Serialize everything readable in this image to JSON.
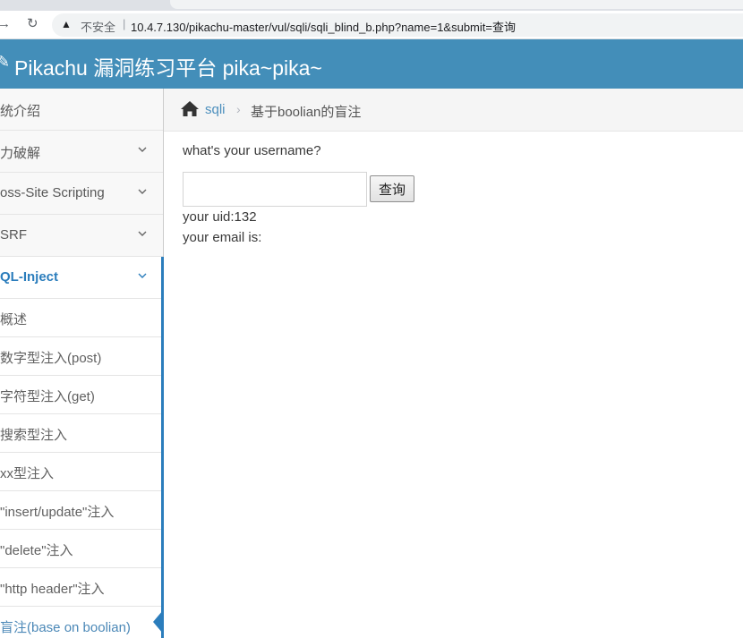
{
  "browser": {
    "forward_icon": "arrow-right",
    "reload_icon": "reload",
    "insecure_label": "不安全",
    "url": "10.4.7.130/pikachu-master/vul/sqli/sqli_blind_b.php?name=1&submit=查询"
  },
  "navbar": {
    "brand": "Pikachu 漏洞练习平台 pika~pika~",
    "color": "#438eb9"
  },
  "sidebar": {
    "items": [
      {
        "label": "统介绍"
      },
      {
        "label": "力破解"
      },
      {
        "label": "oss-Site Scripting"
      },
      {
        "label": "SRF"
      },
      {
        "label": "QL-Inject"
      }
    ],
    "subitems": [
      {
        "label": "概述"
      },
      {
        "label": "数字型注入(post)"
      },
      {
        "label": "字符型注入(get)"
      },
      {
        "label": "搜索型注入"
      },
      {
        "label": "xx型注入"
      },
      {
        "label": "\"insert/update\"注入"
      },
      {
        "label": "\"delete\"注入"
      },
      {
        "label": "\"http header\"注入"
      },
      {
        "label": "盲注(base on boolian)"
      }
    ],
    "active_color": "#2b7dbc"
  },
  "breadcrumb": {
    "link": "sqli",
    "current": "基于boolian的盲注"
  },
  "form": {
    "question": "what's your username?",
    "input_value": "",
    "submit_label": "查询"
  },
  "result": {
    "uid_line": "your uid:132",
    "email_line": "your email is:"
  }
}
